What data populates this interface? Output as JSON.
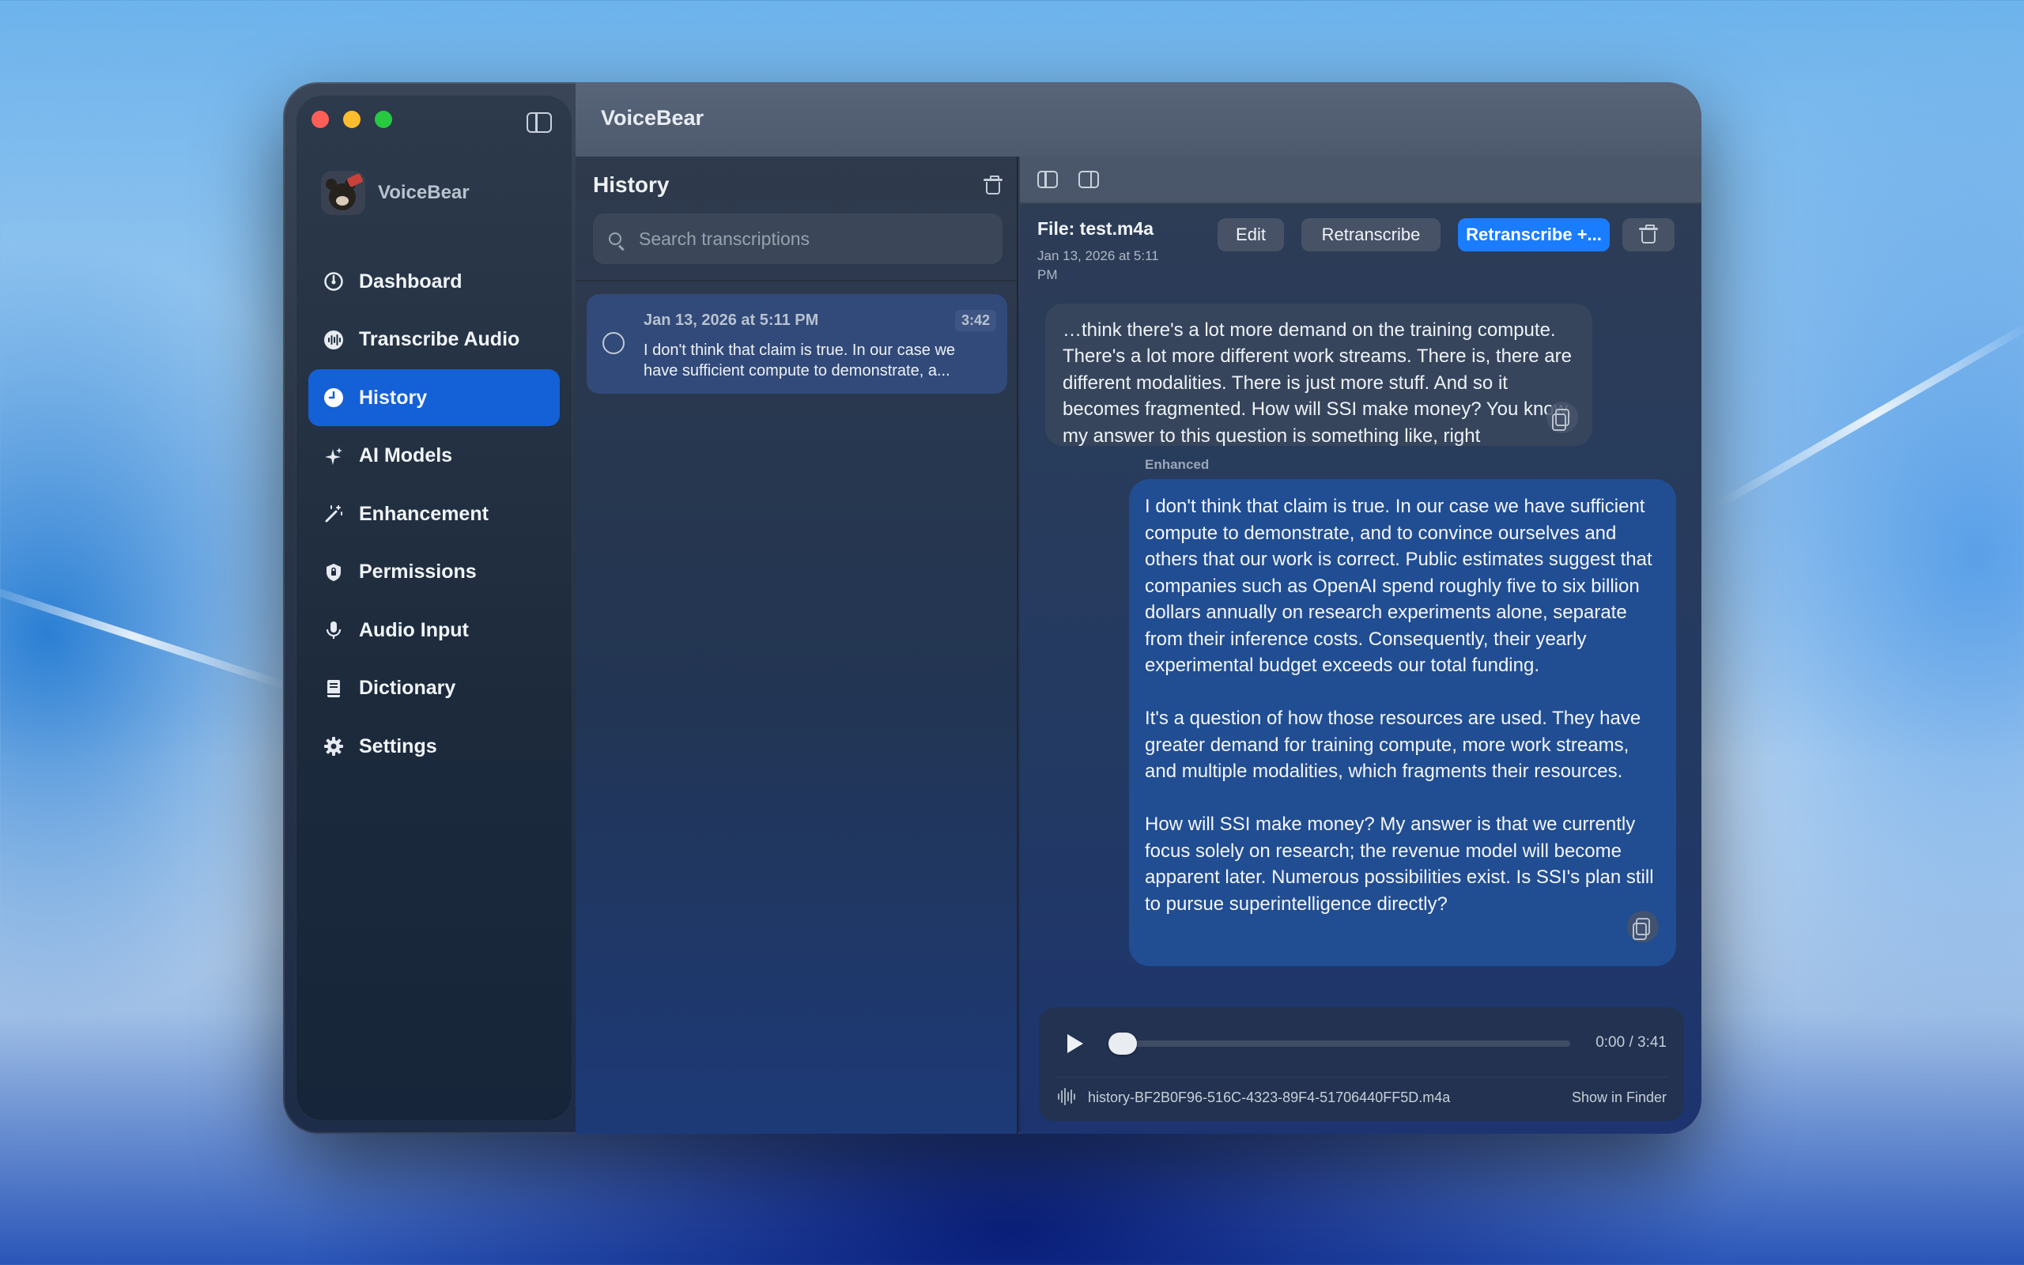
{
  "app": {
    "title": "VoiceBear",
    "brand_name": "VoiceBear"
  },
  "sidebar": {
    "items": [
      {
        "label": "Dashboard",
        "icon": "gauge-icon",
        "active": false
      },
      {
        "label": "Transcribe Audio",
        "icon": "waveform-circle-icon",
        "active": false
      },
      {
        "label": "History",
        "icon": "clock-icon",
        "active": true
      },
      {
        "label": "AI Models",
        "icon": "sparkles-icon",
        "active": false
      },
      {
        "label": "Enhancement",
        "icon": "magic-wand-icon",
        "active": false
      },
      {
        "label": "Permissions",
        "icon": "shield-icon",
        "active": false
      },
      {
        "label": "Audio Input",
        "icon": "microphone-icon",
        "active": false
      },
      {
        "label": "Dictionary",
        "icon": "book-icon",
        "active": false
      },
      {
        "label": "Settings",
        "icon": "gear-icon",
        "active": false
      }
    ]
  },
  "history": {
    "title": "History",
    "search_placeholder": "Search transcriptions",
    "items": [
      {
        "date": "Jan 13, 2026 at 5:11 PM",
        "duration": "3:42",
        "preview": "I don't think that claim is true. In our case we have sufficient compute to demonstrate, a..."
      }
    ]
  },
  "detail": {
    "file_title": "File: test.m4a",
    "file_date": "Jan 13, 2026 at 5:11 PM",
    "buttons": {
      "edit": "Edit",
      "retranscribe": "Retranscribe",
      "retranscribe_plus": "Retranscribe +..."
    },
    "original_text": "…think there's a lot more demand on the training compute. There's a lot more different work streams. There is, there are different modalities. There is just more stuff. And so it becomes fragmented. How will SSI make money? You know, my answer to this question is something like, right",
    "enhanced_label": "Enhanced",
    "enhanced_paragraphs": [
      "I don't think that claim is true. In our case we have sufficient compute to demonstrate, and to convince ourselves and others that our work is correct. Public estimates suggest that companies such as OpenAI spend roughly five to six billion dollars annually on research experiments alone, separate from their inference costs. Consequently, their yearly experimental budget exceeds our total funding.",
      "It's a question of how those resources are used. They have greater demand for training compute, more work streams, and multiple modalities, which fragments their resources.",
      "How will SSI make money? My answer is that we currently focus solely on research; the revenue model will become apparent later. Numerous possibilities exist. Is SSI's plan still to pursue superintelligence directly?"
    ]
  },
  "player": {
    "time": "0:00 / 3:41",
    "progress": 0,
    "file_name": "history-BF2B0F96-516C-4323-89F4-51706440FF5D.m4a",
    "show_in_finder": "Show in Finder"
  },
  "colors": {
    "accent": "#1460d6",
    "primary_button": "#1a7cff",
    "traffic_close": "#ff5f57",
    "traffic_minimize": "#febc2e",
    "traffic_zoom": "#28c840"
  }
}
